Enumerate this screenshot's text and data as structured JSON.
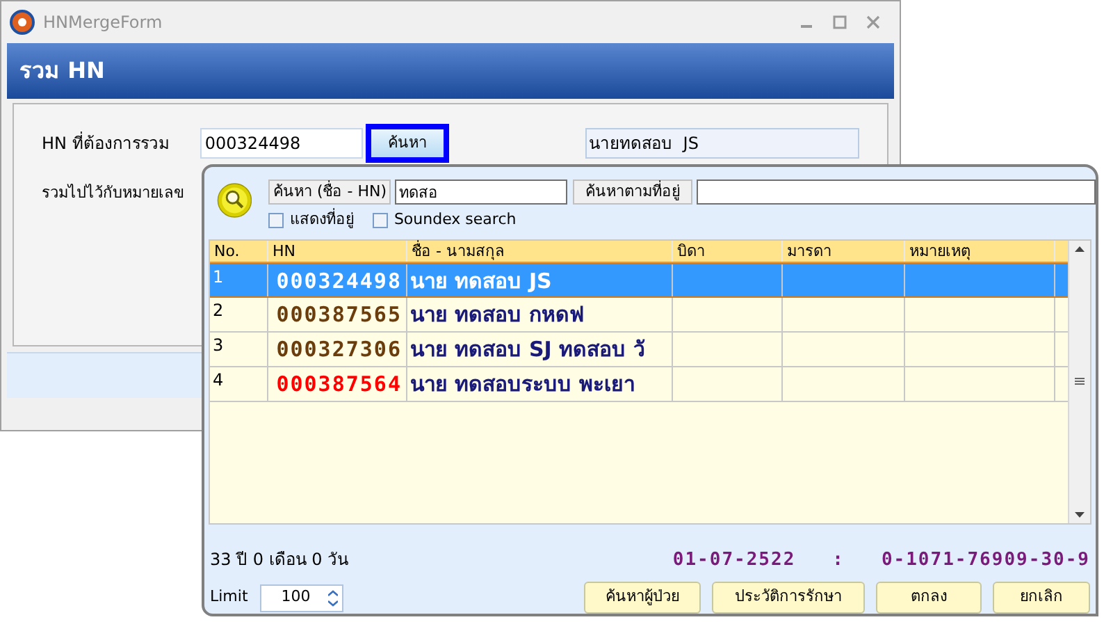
{
  "window": {
    "title": "HNMergeForm"
  },
  "header": {
    "title": "รวม HN"
  },
  "form": {
    "hn_label": "HN ที่ต้องการรวม",
    "hn_value": "000324498",
    "search_button": "ค้นหา",
    "name_value": "นายทดสอบ  JS",
    "merge_label": "รวมไปไว้กับหมายเลข"
  },
  "popup": {
    "search_name_label": "ค้นหา (ชื่อ - HN)",
    "search_name_value": "ทดสอ",
    "address_button": "ค้นหาตามที่อยู่",
    "checkboxes": [
      {
        "label": "แสดงที่อยู่",
        "checked": false
      },
      {
        "label": "Soundex search",
        "checked": false
      }
    ],
    "table": {
      "columns": [
        "No.",
        "HN",
        "ชื่อ - นามสกุล",
        "บิดา",
        "มารดา",
        "หมายเหตุ"
      ],
      "rows": [
        {
          "no": "1",
          "hn": "000324498",
          "name": "นาย ทดสอบ  JS",
          "selected": true
        },
        {
          "no": "2",
          "hn": "000387565",
          "name": "นาย ทดสอบ  กหดฟ",
          "selected": false,
          "color": "#6b3d0c"
        },
        {
          "no": "3",
          "hn": "000327306",
          "name": "นาย ทดสอบ SJ  ทดสอบ วั",
          "selected": false,
          "color": "#6b3d0c"
        },
        {
          "no": "4",
          "hn": "000387564",
          "name": "นาย ทดสอบระบบ  พะเยา",
          "selected": false,
          "color": "#ff0000"
        }
      ]
    },
    "age": "33 ปี 0 เดือน 0 วัน",
    "birth_info": "01-07-2522   :   0-1071-76909-30-9",
    "limit_label": "Limit",
    "limit_value": "100",
    "buttons": [
      "ค้นหาผู้ป่วย",
      "ประวัติการรักษา",
      "ตกลง",
      "ยกเลิก"
    ]
  }
}
